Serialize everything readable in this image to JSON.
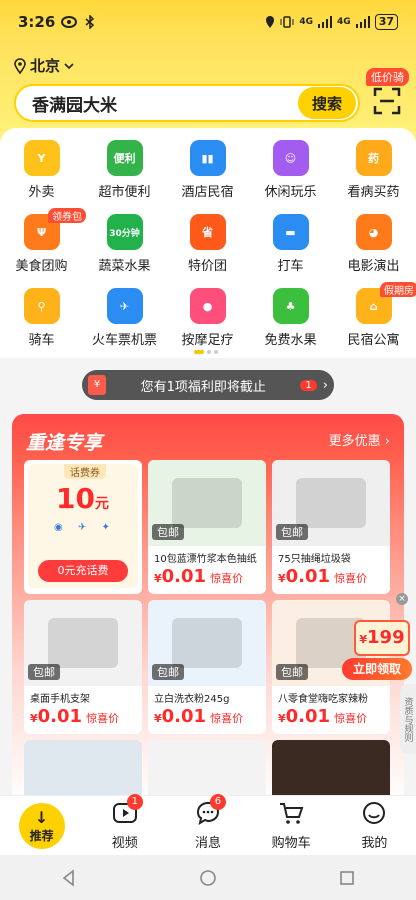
{
  "status": {
    "time": "3:26",
    "battery": "37",
    "net1": "4G",
    "net2": "4G"
  },
  "location": "北京",
  "search": {
    "query": "香满园大米",
    "button": "搜索"
  },
  "scan_tag": "低价骑",
  "categories": [
    {
      "label": "外卖",
      "color": "#ffc21a",
      "icon": "kangaroo-icon",
      "glyph": "Y"
    },
    {
      "label": "超市便利",
      "color": "#34b34a",
      "icon": "basket-icon",
      "glyph": "便利"
    },
    {
      "label": "酒店民宿",
      "color": "#2b8cf2",
      "icon": "building-icon",
      "glyph": "▮▮"
    },
    {
      "label": "休闲玩乐",
      "color": "#a35cf0",
      "icon": "play-icon",
      "glyph": "☺"
    },
    {
      "label": "看病买药",
      "color": "#ffaa1a",
      "icon": "medicine-icon",
      "glyph": "药"
    },
    {
      "label": "美食团购",
      "color": "#ff7a1a",
      "icon": "fork-icon",
      "glyph": "Ψ",
      "tag": "领券包"
    },
    {
      "label": "蔬菜水果",
      "color": "#22b24c",
      "icon": "veggie-icon",
      "glyph": "30分钟"
    },
    {
      "label": "特价团",
      "color": "#ff5a1a",
      "icon": "save-tag-icon",
      "glyph": "省"
    },
    {
      "label": "打车",
      "color": "#2b8cf2",
      "icon": "car-icon",
      "glyph": "▬"
    },
    {
      "label": "电影演出",
      "color": "#ff7a1a",
      "icon": "cat-icon",
      "glyph": "◕"
    },
    {
      "label": "骑车",
      "color": "#ffb21a",
      "icon": "bike-icon",
      "glyph": "⚲"
    },
    {
      "label": "火车票机票",
      "color": "#2b8cf2",
      "icon": "plane-icon",
      "glyph": "✈"
    },
    {
      "label": "按摩足疗",
      "color": "#ff4f7a",
      "icon": "foot-icon",
      "glyph": "●"
    },
    {
      "label": "免费水果",
      "color": "#3cbf3c",
      "icon": "tree-icon",
      "glyph": "♣"
    },
    {
      "label": "民宿公寓",
      "color": "#ffb21a",
      "icon": "house-icon",
      "glyph": "⌂",
      "tag": "假期房"
    }
  ],
  "benefit": {
    "text": "您有1项福利即将截止",
    "count": "1",
    "icon": "¥"
  },
  "promo": {
    "title": "重逢专享",
    "more": "更多优惠",
    "coupon": {
      "tag": "话费券",
      "amount": "10",
      "unit": "元",
      "button": "0元充话费"
    },
    "products": [
      {
        "name": "10包蓝漂竹浆本色抽纸",
        "price": "0.01",
        "note": "惊喜价",
        "badge": "包邮",
        "color": "#e7f3e5"
      },
      {
        "name": "75只抽绳垃圾袋",
        "price": "0.01",
        "note": "惊喜价",
        "badge": "包邮",
        "color": "#efefef"
      },
      {
        "name": "桌面手机支架",
        "price": "0.01",
        "note": "惊喜价",
        "badge": "包邮",
        "color": "#f2f2f2"
      },
      {
        "name": "立白洗衣粉245g",
        "price": "0.01",
        "note": "惊喜价",
        "badge": "包邮",
        "color": "#eaf3fb"
      },
      {
        "name": "八零食堂嗨吃家辣粉",
        "price": "0.01",
        "note": "惊喜价",
        "badge": "包邮",
        "color": "#fbeee2"
      }
    ],
    "currency": "¥"
  },
  "float": {
    "price": "199",
    "currency": "¥",
    "label": "立即领取",
    "side": "资质与规则"
  },
  "tabs": [
    {
      "label": "推荐",
      "icon": "down-arrow-icon"
    },
    {
      "label": "视频",
      "icon": "video-icon",
      "badge": "1"
    },
    {
      "label": "消息",
      "icon": "message-icon",
      "badge": "6"
    },
    {
      "label": "购物车",
      "icon": "cart-icon"
    },
    {
      "label": "我的",
      "icon": "smile-icon"
    }
  ]
}
